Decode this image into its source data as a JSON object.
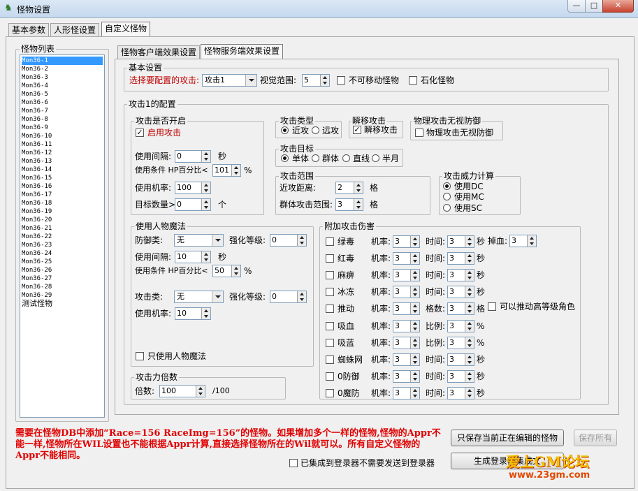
{
  "window": {
    "title": "怪物设置",
    "min": "—",
    "max": "□",
    "close": "✕"
  },
  "tabs": [
    "基本参数",
    "人形怪设置",
    "自定义怪物"
  ],
  "list": {
    "title": "怪物列表",
    "items": [
      "Mon36-1",
      "Mon36-2",
      "Mon36-3",
      "Mon36-4",
      "Mon36-5",
      "Mon36-6",
      "Mon36-7",
      "Mon36-8",
      "Mon36-9",
      "Mon36-10",
      "Mon36-11",
      "Mon36-12",
      "Mon36-13",
      "Mon36-14",
      "Mon36-15",
      "Mon36-16",
      "Mon36-17",
      "Mon36-18",
      "Mon36-19",
      "Mon36-20",
      "Mon36-21",
      "Mon36-22",
      "Mon36-23",
      "Mon36-24",
      "Mon36-25",
      "Mon36-26",
      "Mon36-27",
      "Mon36-28",
      "Mon36-29"
    ],
    "last": "测试怪物"
  },
  "subtabs": [
    "怪物客户端效果设置",
    "怪物服务端效果设置"
  ],
  "basic": {
    "title": "基本设置",
    "attack_label": "选择要配置的攻击:",
    "attack_value": "攻击1",
    "view_label": "视觉范围:",
    "view_value": "5",
    "immovable": "不可移动怪物",
    "stone": "石化怪物"
  },
  "attack_cfg": {
    "title": "攻击1的配置"
  },
  "enable": {
    "title": "攻击是否开启",
    "check": "启用攻击",
    "interval_label": "使用间隔:",
    "interval_value": "0",
    "interval_unit": "秒",
    "cond_label": "使用条件 HP百分比<",
    "cond_value": "101",
    "cond_unit": "%",
    "rate_label": "使用机率:",
    "rate_value": "100",
    "targets_label": "目标数量>",
    "targets_value": "0",
    "targets_unit": "个"
  },
  "type": {
    "title": "攻击类型",
    "near": "近攻",
    "far": "远攻"
  },
  "blink": {
    "title": "瞬移攻击",
    "check": "瞬移攻击"
  },
  "ignore": {
    "title": "物理攻击无视防御",
    "check": "物理攻击无视防御"
  },
  "target": {
    "title": "攻击目标",
    "single": "单体",
    "group": "群体",
    "line": "直线",
    "half": "半月"
  },
  "range": {
    "title": "攻击范围",
    "near_label": "近攻距离:",
    "near_value": "2",
    "near_unit": "格",
    "group_label": "群体攻击范围:",
    "group_value": "3",
    "group_unit": "格"
  },
  "power": {
    "title": "攻击威力计算",
    "dc": "使用DC",
    "mc": "使用MC",
    "sc": "使用SC"
  },
  "magic": {
    "title": "使用人物魔法",
    "def_label": "防御类:",
    "def_value": "无",
    "lvl_label": "强化等级:",
    "lvl1_value": "0",
    "interval_label": "使用间隔:",
    "interval_value": "10",
    "interval_unit": "秒",
    "cond_label": "使用条件 HP百分比<",
    "cond_value": "50",
    "cond_unit": "%",
    "atk_label": "攻击类:",
    "atk_value": "无",
    "lvl2_value": "0",
    "rate_label": "使用机率:",
    "rate_value": "10",
    "only": "只使用人物魔法"
  },
  "mult": {
    "title": "攻击力倍数",
    "label": "倍数:",
    "value": "100",
    "unit": "/100"
  },
  "extra": {
    "title": "附加攻击伤害",
    "rate_label": "机率:",
    "rows": [
      {
        "name": "绿毒",
        "rate": "3",
        "p_label": "时间:",
        "p_value": "3",
        "p_unit": "秒"
      },
      {
        "name": "红毒",
        "rate": "3",
        "p_label": "时间:",
        "p_value": "3",
        "p_unit": "秒"
      },
      {
        "name": "麻痹",
        "rate": "3",
        "p_label": "时间:",
        "p_value": "3",
        "p_unit": "秒"
      },
      {
        "name": "冰冻",
        "rate": "3",
        "p_label": "时间:",
        "p_value": "3",
        "p_unit": "秒"
      },
      {
        "name": "推动",
        "rate": "3",
        "p_label": "格数:",
        "p_value": "3",
        "p_unit": "格"
      },
      {
        "name": "吸血",
        "rate": "3",
        "p_label": "比例:",
        "p_value": "3",
        "p_unit": "%"
      },
      {
        "name": "吸蓝",
        "rate": "3",
        "p_label": "比例:",
        "p_value": "3",
        "p_unit": "%"
      },
      {
        "name": "蜘蛛网",
        "rate": "3",
        "p_label": "时间:",
        "p_value": "3",
        "p_unit": "秒"
      },
      {
        "name": "0防御",
        "rate": "3",
        "p_label": "时间:",
        "p_value": "3",
        "p_unit": "秒"
      },
      {
        "name": "0魔防",
        "rate": "3",
        "p_label": "时间:",
        "p_value": "3",
        "p_unit": "秒"
      }
    ],
    "drop_label": "掉血:",
    "drop_value": "3",
    "push_high": "可以推动高等级角色"
  },
  "notice": "需要在怪物DB中添加“Race=156 RaceImg=156”的怪物。如果增加多个一样的怪物,怪物的Appr不能一样,怪物所在WIL设置也不能根据Appr计算,直接选择怪物所在的Wil就可以。所有自定义怪物的Appr不能相同。",
  "buttons": {
    "save_current": "只保存当前正在编辑的怪物",
    "save_all": "保存所有",
    "gen": "生成登录器集成文"
  },
  "integrated": "已集成到登录器不需要发送到登录器",
  "watermark": {
    "line1": "爱上GM论坛",
    "line2": "www.23gm.com"
  }
}
